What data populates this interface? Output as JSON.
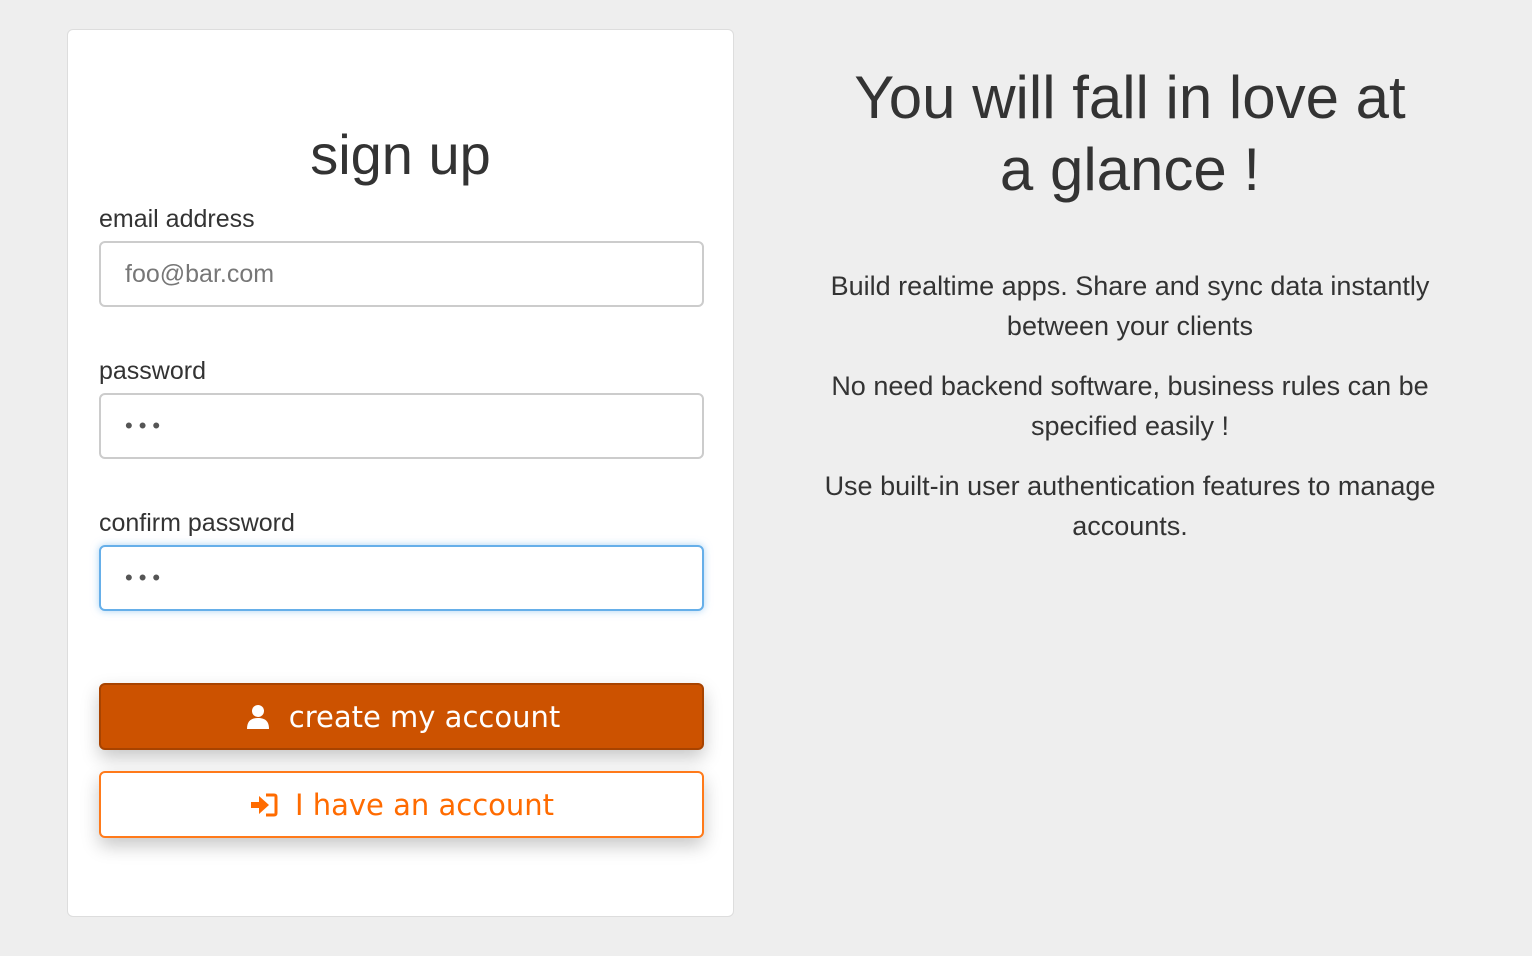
{
  "signup": {
    "title": "sign up",
    "email": {
      "label": "email address",
      "placeholder": "foo@bar.com"
    },
    "password": {
      "label": "password",
      "value": "•••"
    },
    "confirm_password": {
      "label": "confirm password",
      "value": "•••"
    },
    "create_button": {
      "label": "create my account",
      "icon": "user-icon"
    },
    "login_button": {
      "label": "I have an account",
      "icon": "sign-in-icon"
    }
  },
  "promo": {
    "headline": "You will fall in love at a glance !",
    "paragraphs": [
      "Build realtime apps. Share and sync data instantly between your clients",
      "No need backend software, business rules can be specified easily !",
      "Use built-in user authentication features to manage accounts."
    ]
  },
  "colors": {
    "background": "#eeeeee",
    "primary": "#cc5200",
    "accent": "#ff6b00",
    "focus": "#66afe9"
  }
}
